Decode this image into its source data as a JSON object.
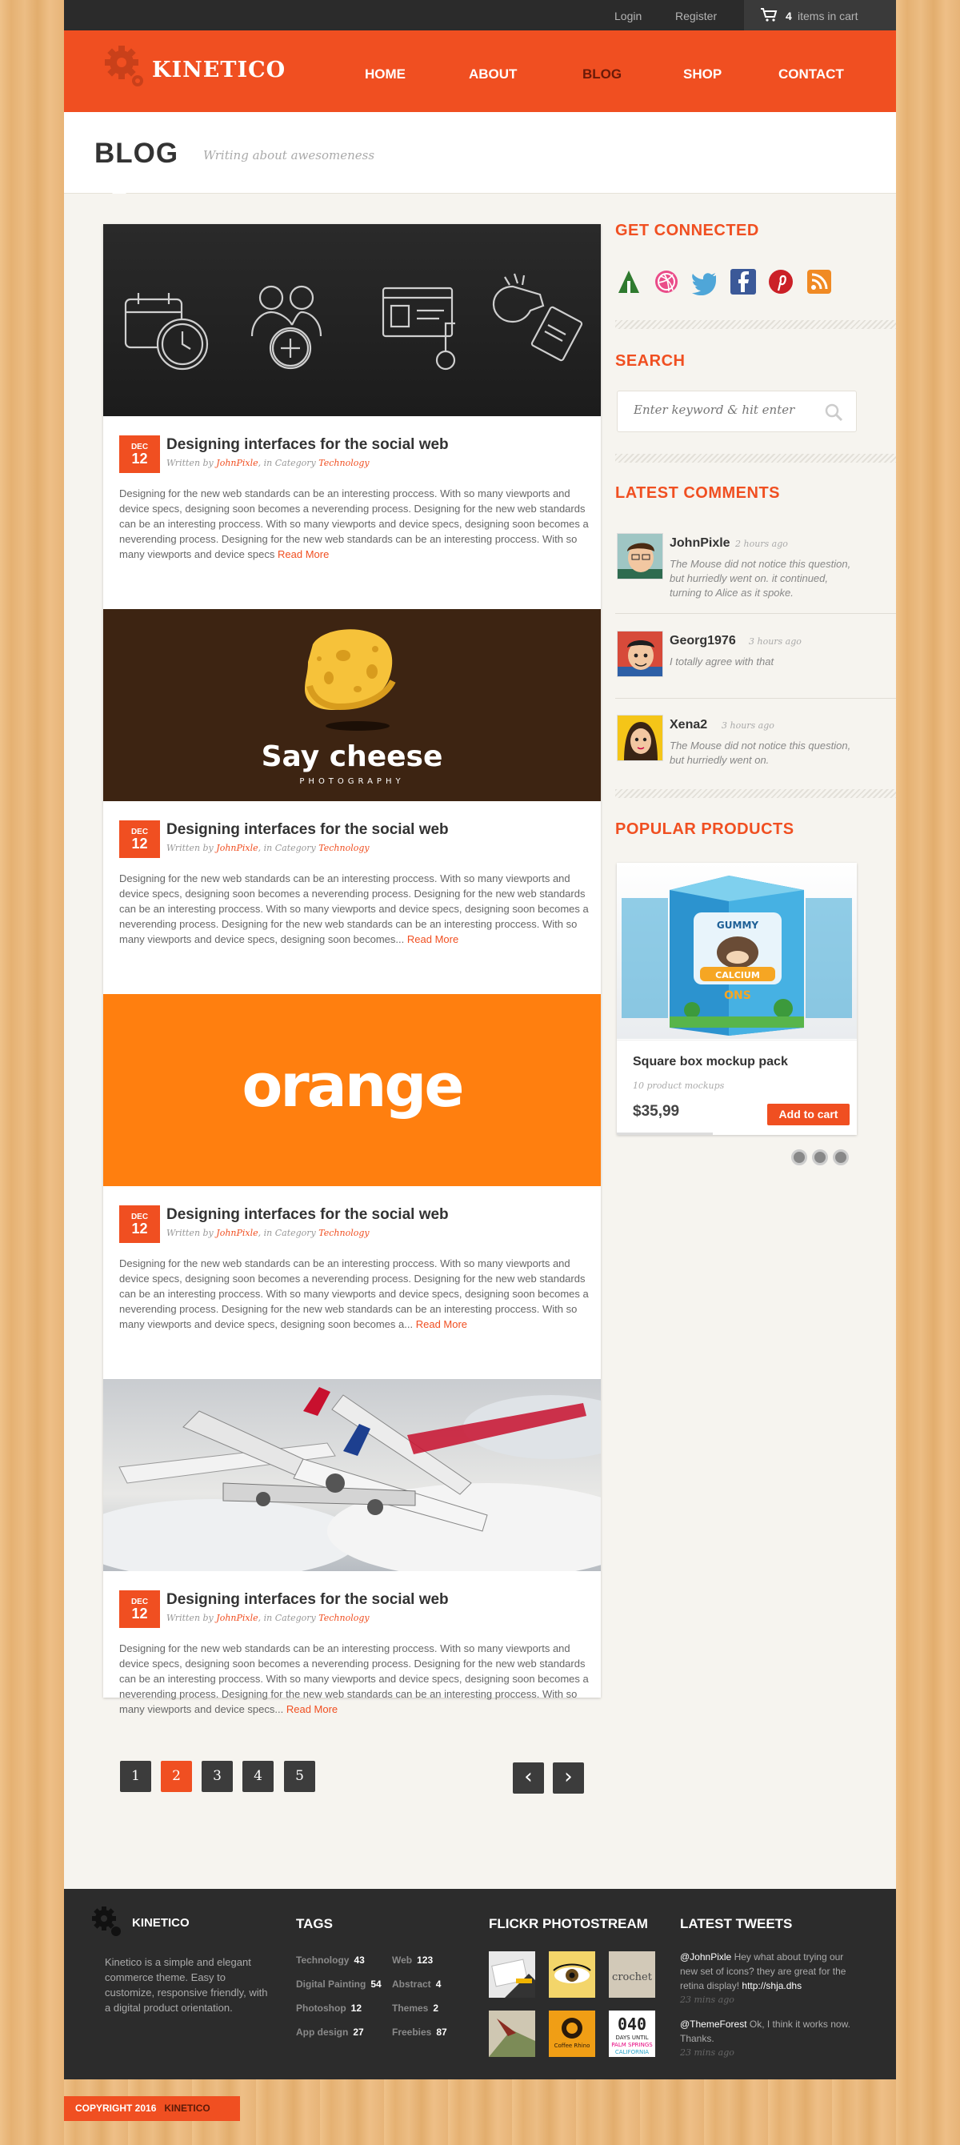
{
  "topbar": {
    "login": "Login",
    "register": "Register",
    "cart_count": "4",
    "cart_text": "items in cart"
  },
  "brand": {
    "name": "KINETICO"
  },
  "nav": {
    "items": [
      {
        "label": "HOME"
      },
      {
        "label": "ABOUT"
      },
      {
        "label": "BLOG"
      },
      {
        "label": "SHOP"
      },
      {
        "label": "CONTACT"
      }
    ],
    "active": "BLOG"
  },
  "page": {
    "title": "BLOG",
    "subtitle": "Writing about awesomeness"
  },
  "posts": [
    {
      "month": "DEC",
      "day": "12",
      "title": "Designing interfaces for the social web",
      "author": "JohnPixle",
      "category": "Technology",
      "excerpt": "Designing for the new web standards can be an interesting proccess. With so many viewports and device specs, designing soon becomes a neverending process. Designing for the new web standards can be an interesting proccess. With so many viewports and device specs, designing soon becomes a neverending process. Designing for the new web standards can be an interesting proccess. With so many viewports and device specs",
      "image": "icons"
    },
    {
      "month": "DEC",
      "day": "12",
      "title": "Designing interfaces for the social web",
      "author": "JohnPixle",
      "category": "Technology",
      "excerpt": "Designing for the new web standards can be an interesting proccess. With so many viewports and device specs, designing soon becomes a neverending process. Designing for the new web standards can be an interesting proccess. With so many viewports and device specs, designing soon becomes a neverending process. Designing for the new web standards can be an interesting proccess. With so many viewports and device specs, designing soon becomes...",
      "image": "say-cheese"
    },
    {
      "month": "DEC",
      "day": "12",
      "title": "Designing interfaces for the social web",
      "author": "JohnPixle",
      "category": "Technology",
      "excerpt": "Designing for the new web standards can be an interesting proccess. With so many viewports and device specs, designing soon becomes a neverending process. Designing for the new web standards can be an interesting proccess. With so many viewports and device specs, designing soon becomes a neverending process. Designing for the new web standards can be an interesting proccess. With so many viewports and device specs, designing soon becomes a...",
      "image": "orange"
    },
    {
      "month": "DEC",
      "day": "12",
      "title": "Designing interfaces for the social web",
      "author": "JohnPixle",
      "category": "Technology",
      "excerpt": "Designing for the new web standards can be an interesting proccess. With so many viewports and device specs, designing soon becomes a neverending process. Designing for the new web standards can be an interesting proccess. With so many viewports and device specs, designing soon becomes a neverending process. Designing for the new web standards can be an interesting proccess. With so many viewports and device specs...",
      "image": "planes"
    }
  ],
  "post_labels": {
    "written_by": "Written by",
    "in_category": ", in Category",
    "read_more": "Read More"
  },
  "cheese": {
    "title": "Say cheese",
    "sub": "PHOTOGRAPHY"
  },
  "orange": {
    "word": "orange"
  },
  "pagination": {
    "pages": [
      "1",
      "2",
      "3",
      "4",
      "5"
    ],
    "current": "2",
    "prev": "‹",
    "next": "›"
  },
  "sidebar": {
    "connected_title": "GET CONNECTED",
    "social": [
      "forrst",
      "dribbble",
      "twitter",
      "facebook",
      "pinterest",
      "rss"
    ],
    "search_title": "SEARCH",
    "search_placeholder": "Enter keyword & hit enter",
    "comments_title": "LATEST COMMENTS",
    "comments": [
      {
        "name": "JohnPixle",
        "time": "2 hours ago",
        "text": "The Mouse did not notice this question, but hurriedly went on. it continued, turning to Alice as it spoke."
      },
      {
        "name": "Georg1976",
        "time": "3 hours ago",
        "text": "I totally agree with that"
      },
      {
        "name": "Xena2",
        "time": "3 hours ago",
        "text": "The Mouse did not notice this question, but hurriedly went on."
      }
    ],
    "products_title": "POPULAR PRODUCTS",
    "product": {
      "name": "Square box mockup pack",
      "sub": "10 product mockups",
      "price": "$35,99",
      "button": "Add to cart",
      "box_brand": "GUMMY",
      "box_label": "CALCIUM",
      "box_tag": "ONS"
    }
  },
  "footer": {
    "brand": "KINETICO",
    "about": "Kinetico is a simple and elegant commerce theme. Easy to customize, responsive friendly, with a digital product orientation.",
    "tags_title": "TAGS",
    "tags": [
      {
        "name": "Technology",
        "count": "43"
      },
      {
        "name": "Web",
        "count": "123"
      },
      {
        "name": "Digital Painting",
        "count": "54"
      },
      {
        "name": "Abstract",
        "count": "4"
      },
      {
        "name": "Photoshop",
        "count": "12"
      },
      {
        "name": "Themes",
        "count": "2"
      },
      {
        "name": "App design",
        "count": "27"
      },
      {
        "name": "Freebies",
        "count": "87"
      }
    ],
    "flickr_title": "FLICKR PHOTOSTREAM",
    "flickr_texts": {
      "crochet": "crochet",
      "coffee": "Coffee Rhino",
      "days_num": "040",
      "days_a": "DAYS UNTIL",
      "days_b": "PALM SPRINGS",
      "days_c": "CALIFORNIA"
    },
    "tweets_title": "LATEST TWEETS",
    "tweets": [
      {
        "user": "@JohnPixle",
        "text": "Hey what about trying our new set of icons? they are great for the retina display!",
        "link": "http://shja.dhs",
        "time": "23 mins ago"
      },
      {
        "user": "@ThemeForest",
        "text": "Ok, I think it works now. Thanks.",
        "link": "",
        "time": "23 mins ago"
      }
    ]
  },
  "copyright": {
    "text": "COPYRIGHT 2016",
    "brand": "KINETICO"
  },
  "colors": {
    "accent": "#f04f21",
    "dark": "#2c2c2c",
    "orange_post": "#ff7f0f",
    "cheese_bg": "#3d2412"
  }
}
